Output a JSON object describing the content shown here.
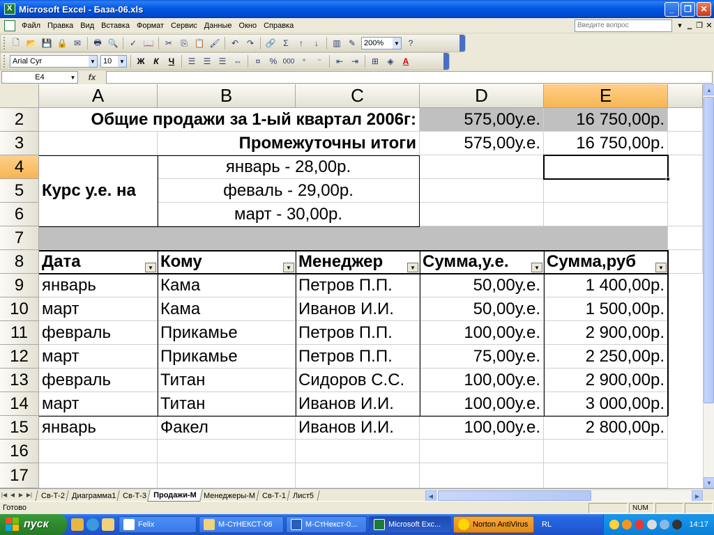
{
  "window": {
    "title": "Microsoft Excel - База-06.xls",
    "controls": {
      "minimize": "_",
      "restore": "❐",
      "close": "✕"
    }
  },
  "menubar": {
    "items": [
      "Файл",
      "Правка",
      "Вид",
      "Вставка",
      "Формат",
      "Сервис",
      "Данные",
      "Окно",
      "Справка"
    ],
    "ask_placeholder": "Введите вопрос"
  },
  "toolbar_standard": {
    "zoom": "200%"
  },
  "toolbar_format": {
    "font": "Arial Cyr",
    "size": "10",
    "bold": "Ж",
    "italic": "К",
    "underline": "Ч",
    "percent": "%",
    "thousands": "000"
  },
  "formula_bar": {
    "name_box": "E4",
    "fx": "fx",
    "formula": ""
  },
  "sheet": {
    "columns": [
      "A",
      "B",
      "C",
      "D",
      "E"
    ],
    "active_column": "E",
    "active_row": "4",
    "rows": [
      "2",
      "3",
      "4",
      "5",
      "6",
      "7",
      "8",
      "9",
      "10",
      "11",
      "12",
      "13",
      "14",
      "15",
      "16",
      "17"
    ],
    "summary": {
      "total_label": "Общие продажи за 1-ый квартал 2006г:",
      "total_ue": "575,00у.е.",
      "total_rub": "16 750,00р.",
      "subtotal_label": "Промежуточны итоги",
      "subtotal_ue": "575,00у.е.",
      "subtotal_rub": "16 750,00р.",
      "rate_label": "Курс у.е. на",
      "rates": [
        "январь - 28,00р.",
        "феваль - 29,00р.",
        "март - 30,00р."
      ]
    },
    "table_headers": [
      "Дата",
      "Кому",
      "Менеджер",
      "Сумма,у.е.",
      "Сумма,руб"
    ],
    "table_rows": [
      [
        "январь",
        "Кама",
        "Петров П.П.",
        "50,00у.е.",
        "1 400,00р."
      ],
      [
        "март",
        "Кама",
        "Иванов И.И.",
        "50,00у.е.",
        "1 500,00р."
      ],
      [
        "февраль",
        "Прикамье",
        "Петров П.П.",
        "100,00у.е.",
        "2 900,00р."
      ],
      [
        "март",
        "Прикамье",
        "Петров П.П.",
        "75,00у.е.",
        "2 250,00р."
      ],
      [
        "февраль",
        "Титан",
        "Сидоров С.С.",
        "100,00у.е.",
        "2 900,00р."
      ],
      [
        "март",
        "Титан",
        "Иванов И.И.",
        "100,00у.е.",
        "3 000,00р."
      ],
      [
        "январь",
        "Факел",
        "Иванов И.И.",
        "100,00у.е.",
        "2 800,00р."
      ]
    ]
  },
  "sheet_tabs": [
    "Св-Т-2",
    "Диаграмма1",
    "Св-Т-3",
    "Продажи-М",
    "Менеджеры-М",
    "Св-Т-1",
    "Лист5"
  ],
  "active_sheet": "Продажи-М",
  "statusbar": {
    "status": "Готово",
    "num": "NUM"
  },
  "taskbar": {
    "start": "пуск",
    "tasks": [
      "Felix",
      "М-СтНЕКСТ-06",
      "М-СтНекст-0...",
      "Microsoft Exc...",
      "Norton AntiVirus"
    ],
    "lang": "RL",
    "clock": "14:17"
  }
}
